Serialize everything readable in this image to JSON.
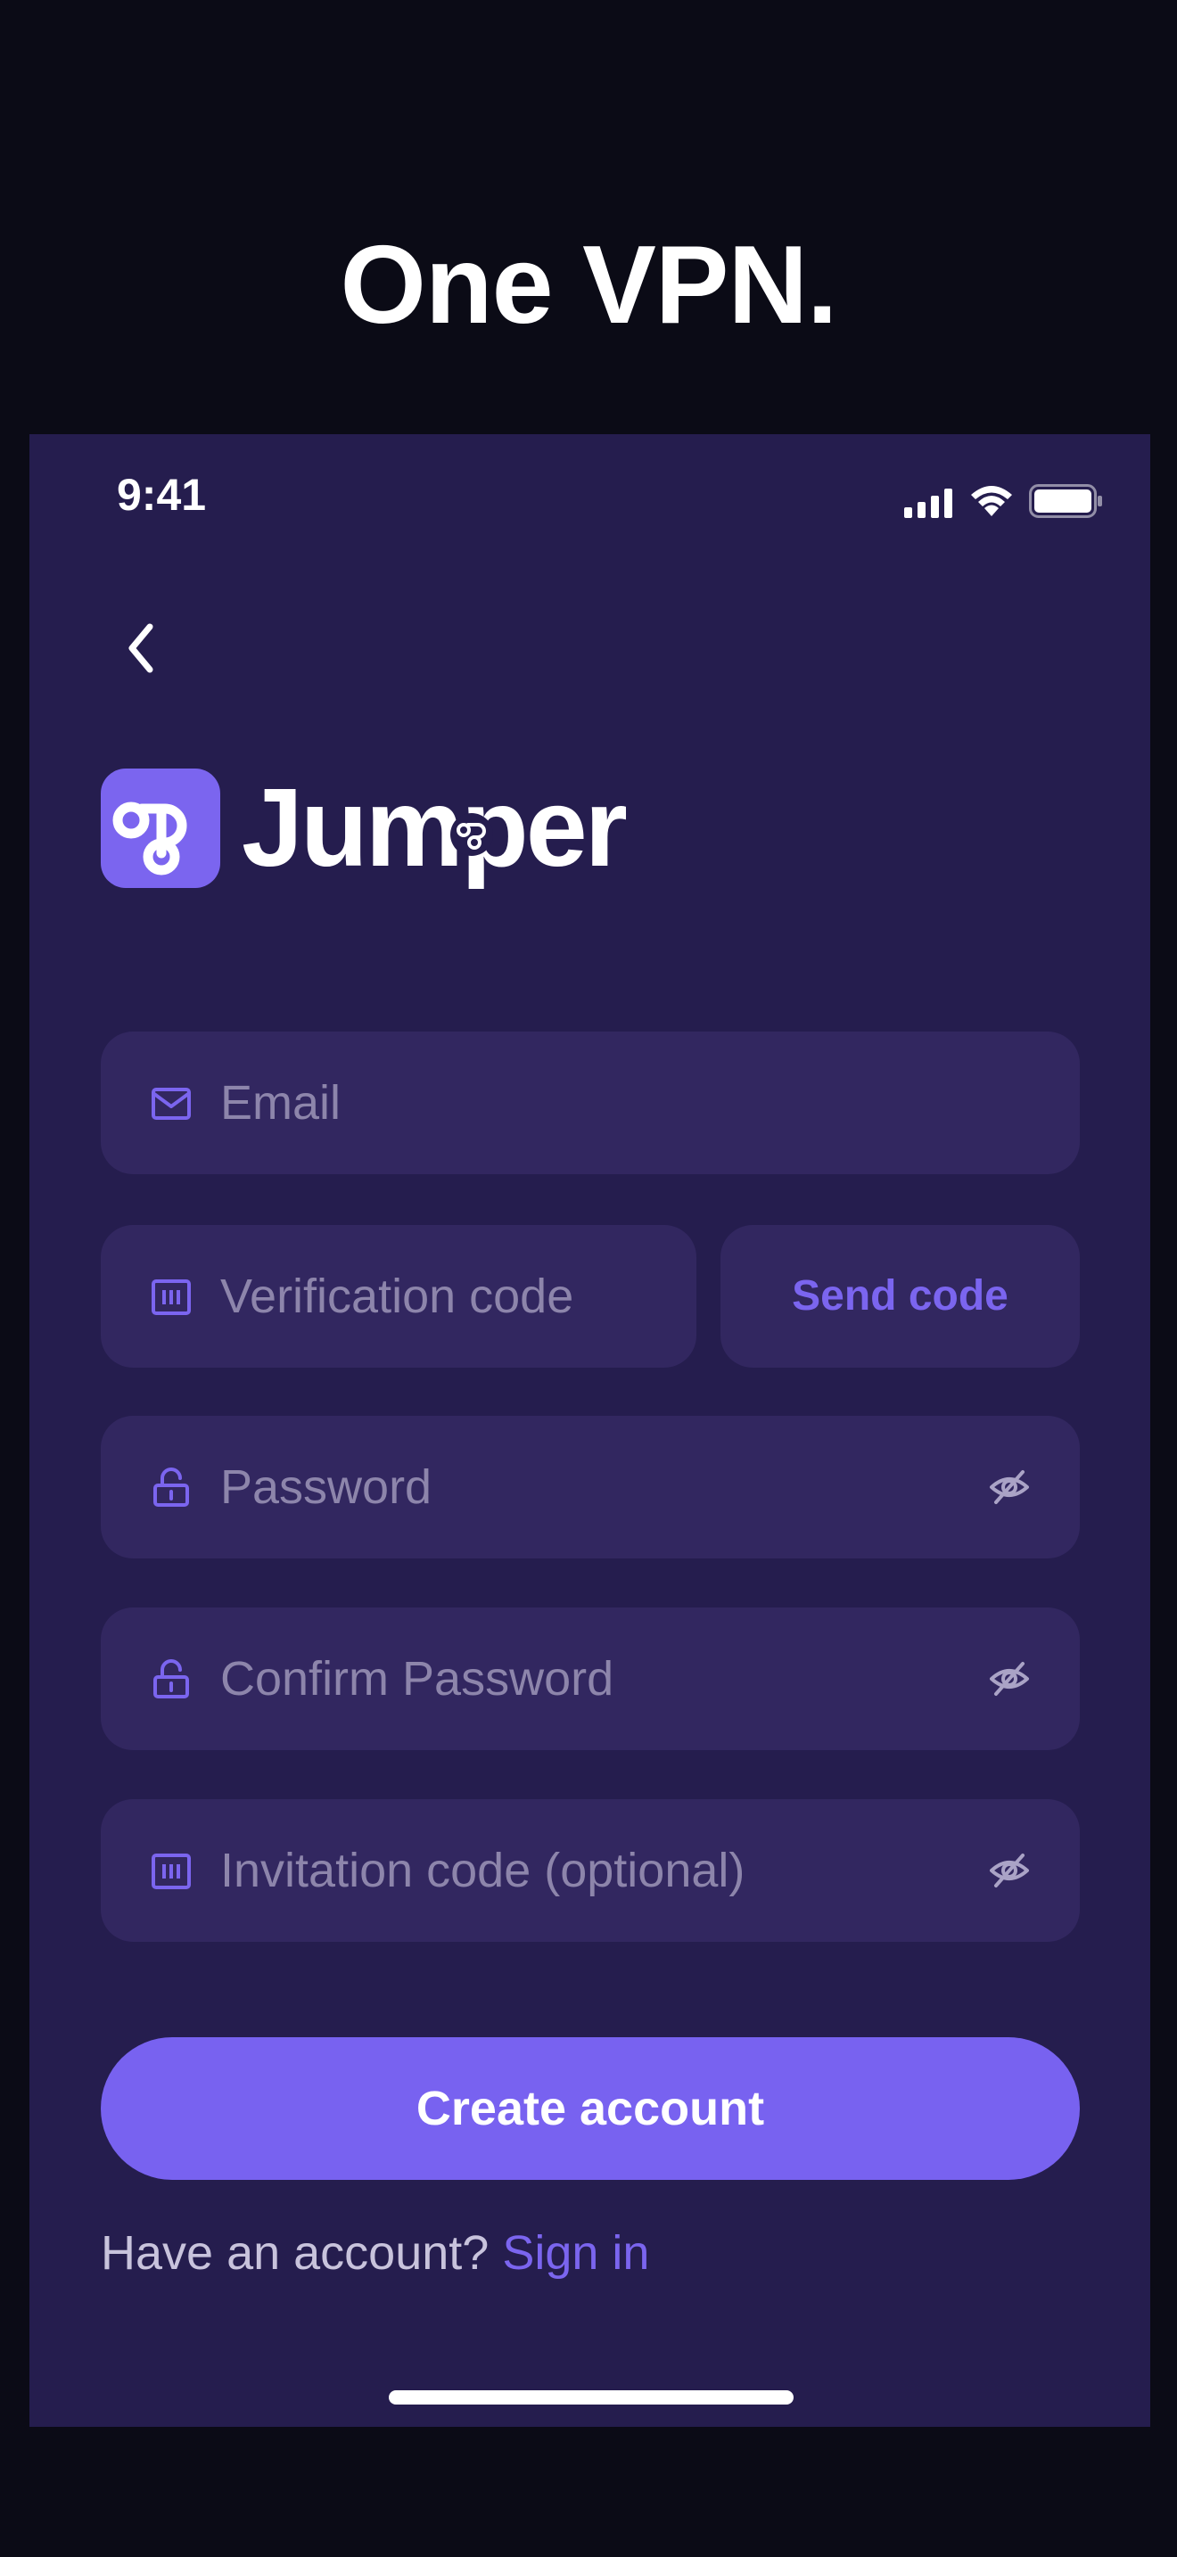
{
  "headline": "One VPN.",
  "status_bar": {
    "time": "9:41",
    "icons": [
      "cellular-signal-icon",
      "wifi-icon",
      "battery-icon"
    ]
  },
  "nav": {
    "back_icon": "chevron-left-icon"
  },
  "brand": {
    "name": "Jumper",
    "logo_icon": "jumper-logo-icon",
    "accent_color": "#7b65ef"
  },
  "form": {
    "email": {
      "placeholder": "Email",
      "value": "",
      "icon": "mail-icon"
    },
    "verification_code": {
      "placeholder": "Verification code",
      "value": "",
      "icon": "code-icon"
    },
    "send_code_label": "Send code",
    "password": {
      "placeholder": "Password",
      "value": "",
      "icon": "lock-icon",
      "toggle_icon": "eye-off-icon"
    },
    "confirm_password": {
      "placeholder": "Confirm Password",
      "value": "",
      "icon": "lock-icon",
      "toggle_icon": "eye-off-icon"
    },
    "invitation_code": {
      "placeholder": "Invitation code (optional)",
      "value": "",
      "icon": "code-icon",
      "toggle_icon": "eye-off-icon"
    },
    "submit_label": "Create account"
  },
  "footer": {
    "prompt": "Have an account?",
    "link_label": "Sign in"
  },
  "colors": {
    "page_background": "#0b0b16",
    "screen_background": "#251d4e",
    "field_background": "#322760",
    "primary": "#7862f0",
    "placeholder": "#8d85ab"
  }
}
